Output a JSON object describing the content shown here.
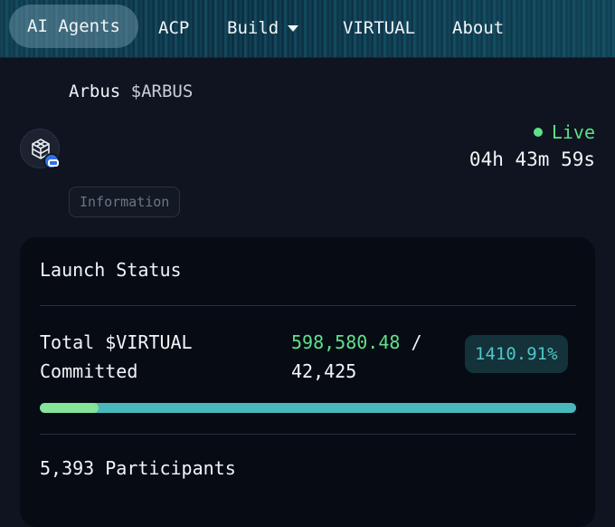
{
  "nav": {
    "items": [
      {
        "label": "AI Agents",
        "active": true
      },
      {
        "label": "ACP"
      },
      {
        "label": "Build",
        "has_dropdown": true
      },
      {
        "label": "VIRTUAL"
      },
      {
        "label": "About"
      }
    ]
  },
  "token": {
    "name": "Arbus",
    "ticker": "$ARBUS",
    "avatar_icon": "cube-logo-icon",
    "chain_badge_icon": "base-chain-icon"
  },
  "status": {
    "live_label": "Live",
    "live_color": "#5fe08a",
    "countdown": "04h 43m 59s"
  },
  "tags": {
    "information": "Information"
  },
  "launch": {
    "title": "Launch Status",
    "total_label": "Total $VIRTUAL Committed",
    "committed": "598,580.48",
    "separator": "/",
    "target": "42,425",
    "percent": "1410.91%",
    "progress_fraction": 0.11,
    "participants": "5,393 Participants"
  },
  "colors": {
    "accent_green": "#5fe08a",
    "accent_teal": "#4fc6c9",
    "background": "#0f1420",
    "card": "#070b14"
  }
}
